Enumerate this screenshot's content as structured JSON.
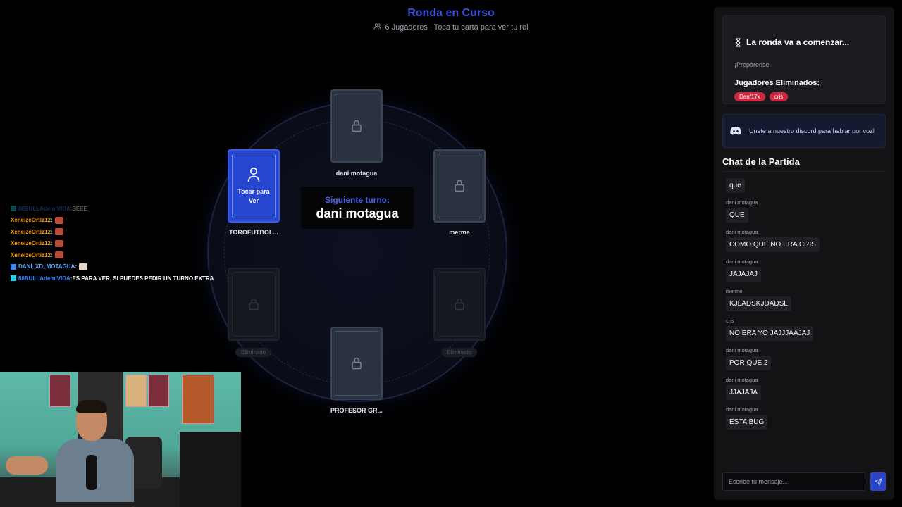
{
  "header": {
    "title": "Ronda en Curso",
    "subtitle": "6 Jugadores | Toca tu carta para ver tu rol"
  },
  "table": {
    "turn_label": "Siguiente turno:",
    "turn_player": "dani motagua",
    "players": [
      {
        "name": "dani motagua",
        "state": "locked"
      },
      {
        "name": "TOROFUTBOL...",
        "state": "active",
        "tap_label": "Tocar para Ver"
      },
      {
        "name": "merme",
        "state": "locked"
      },
      {
        "name": "Eliminado",
        "state": "eliminated"
      },
      {
        "name": "Eliminado",
        "state": "eliminated"
      },
      {
        "name": "PROFESOR GR...",
        "state": "locked"
      }
    ]
  },
  "stream_chat": [
    {
      "user": "88BULLAdemiVIDA",
      "sep": " : ",
      "msg": "SEEE",
      "color": "#3b82f6",
      "faded": true
    },
    {
      "user": "XeneizeOrtiz12",
      "sep": " : ",
      "msg": "",
      "color": "#f59e0b",
      "emote": true
    },
    {
      "user": "XeneizeOrtiz12",
      "sep": " : ",
      "msg": "",
      "color": "#f59e0b",
      "emote": true
    },
    {
      "user": "XeneizeOrtiz12",
      "sep": " : ",
      "msg": "",
      "color": "#f59e0b",
      "emote": true
    },
    {
      "user": "XeneizeOrtiz12",
      "sep": " : ",
      "msg": "",
      "color": "#f59e0b",
      "emote": true
    },
    {
      "user": "DANI_XD_MOTAGUA",
      "sep": " : ",
      "msg": "",
      "color": "#60a5fa",
      "emote": true
    },
    {
      "user": "88BULLAdemiVIDA",
      "sep": " : ",
      "msg": "ES PARA VER, SI PUEDES PEDIR UN TURNO EXTRA",
      "color": "#3b82f6"
    }
  ],
  "round": {
    "title": "La ronda va a comenzar...",
    "subtitle": "¡Prepárense!",
    "eliminated_label": "Jugadores Eliminados:",
    "eliminated": [
      "Danf17x",
      "cris"
    ]
  },
  "discord": {
    "text": "¡Unete a nuestro discord para hablar por voz!"
  },
  "chat": {
    "title": "Chat de la Partida",
    "messages": [
      {
        "user": "",
        "text": "que"
      },
      {
        "user": "dani motagua",
        "text": "QUE"
      },
      {
        "user": "dani motagua",
        "text": "COMO QUE NO ERA CRIS"
      },
      {
        "user": "dani motagua",
        "text": "JAJAJAJ"
      },
      {
        "user": "merme",
        "text": "KJLADSKJDADSL"
      },
      {
        "user": "cris",
        "text": "NO ERA YO JAJJJAAJAJ"
      },
      {
        "user": "dani motagua",
        "text": "POR QUE 2"
      },
      {
        "user": "dani motagua",
        "text": "JJAJAJA"
      },
      {
        "user": "dani motagua",
        "text": "ESTA BUG"
      }
    ],
    "input_placeholder": "Escribe tu mensaje..."
  }
}
